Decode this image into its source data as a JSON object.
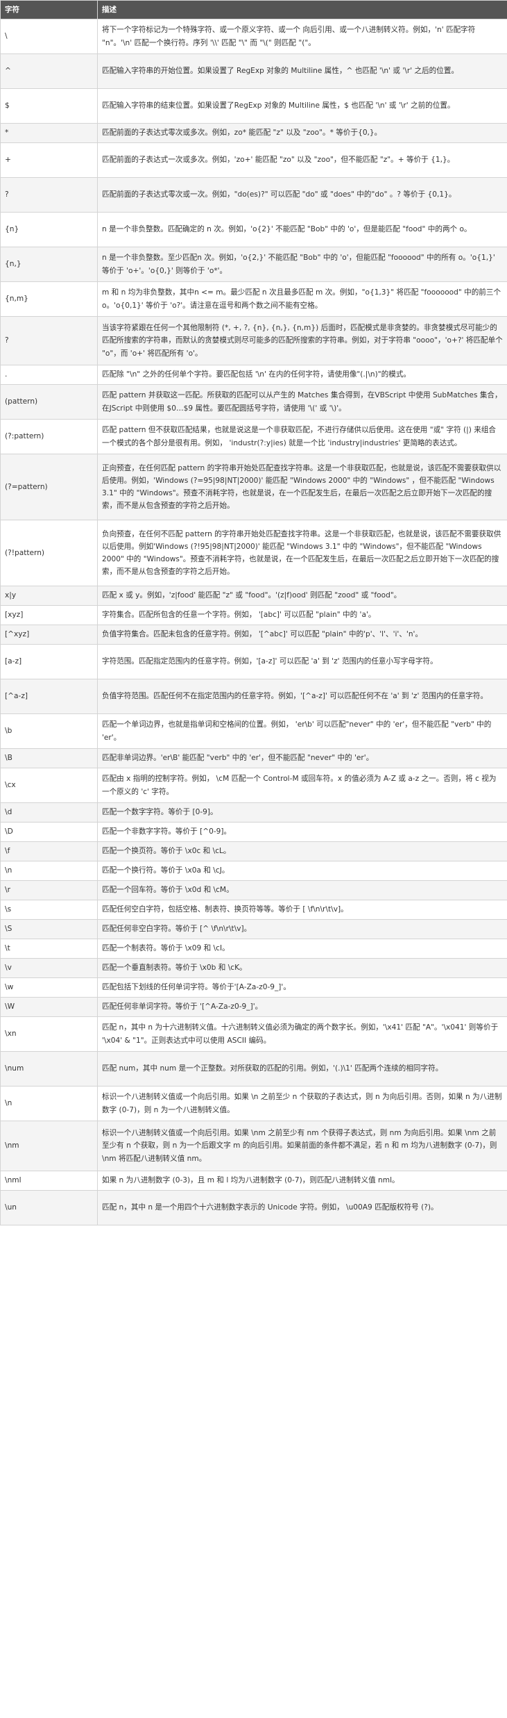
{
  "table": {
    "headers": [
      "字符",
      "描述"
    ],
    "rows": [
      {
        "char": "\\",
        "desc": "将下一个字符标记为一个特殊字符、或一个原义字符、或一个 向后引用、或一个八进制转义符。例如，'n' 匹配字符 \"n\"。'\\n' 匹配一个换行符。序列 '\\\\' 匹配 \"\\\" 而 \"\\(\" 则匹配 \"(\"。"
      },
      {
        "char": "^",
        "desc": "匹配输入字符串的开始位置。如果设置了 RegExp 对象的 Multiline 属性，^ 也匹配 '\\n' 或 '\\r' 之后的位置。"
      },
      {
        "char": "$",
        "desc": "匹配输入字符串的结束位置。如果设置了RegExp 对象的 Multiline 属性，$ 也匹配 '\\n' 或 '\\r' 之前的位置。"
      },
      {
        "char": "*",
        "desc": "匹配前面的子表达式零次或多次。例如，zo* 能匹配 \"z\" 以及 \"zoo\"。* 等价于{0,}。"
      },
      {
        "char": "+",
        "desc": "匹配前面的子表达式一次或多次。例如，'zo+' 能匹配 \"zo\" 以及 \"zoo\"，但不能匹配 \"z\"。+ 等价于 {1,}。"
      },
      {
        "char": "?",
        "desc": "匹配前面的子表达式零次或一次。例如，\"do(es)?\" 可以匹配 \"do\" 或 \"does\" 中的\"do\" 。? 等价于 {0,1}。"
      },
      {
        "char": "{n}",
        "desc": "n 是一个非负整数。匹配确定的 n 次。例如，'o{2}' 不能匹配 \"Bob\" 中的 'o'，但是能匹配 \"food\" 中的两个 o。"
      },
      {
        "char": "{n,}",
        "desc": "n 是一个非负整数。至少匹配n 次。例如，'o{2,}' 不能匹配 \"Bob\" 中的 'o'，但能匹配 \"foooood\" 中的所有 o。'o{1,}' 等价于 'o+'。'o{0,}' 则等价于 'o*'。"
      },
      {
        "char": "{n,m}",
        "desc": "m 和 n 均为非负整数，其中n <= m。最少匹配 n 次且最多匹配 m 次。例如，\"o{1,3}\" 将匹配 \"fooooood\" 中的前三个 o。'o{0,1}' 等价于 'o?'。请注意在逗号和两个数之间不能有空格。"
      },
      {
        "char": "?",
        "desc": "当该字符紧跟在任何一个其他限制符 (*, +, ?, {n}, {n,}, {n,m}) 后面时，匹配模式是非贪婪的。非贪婪模式尽可能少的匹配所搜索的字符串，而默认的贪婪模式则尽可能多的匹配所搜索的字符串。例如，对于字符串 \"oooo\"，'o+?' 将匹配单个 \"o\"，而 'o+' 将匹配所有 'o'。"
      },
      {
        "char": ".",
        "desc": "匹配除 \"\\n\" 之外的任何单个字符。要匹配包括 '\\n' 在内的任何字符，请使用像\"(.|\\n)\"的模式。"
      },
      {
        "char": "(pattern)",
        "desc": "匹配 pattern 并获取这一匹配。所获取的匹配可以从产生的 Matches 集合得到，在VBScript 中使用 SubMatches 集合，在JScript 中则使用 $0…$9 属性。要匹配圆括号字符，请使用 '\\(' 或 '\\)'。"
      },
      {
        "char": "(?:pattern)",
        "desc": "匹配 pattern 但不获取匹配结果，也就是说这是一个非获取匹配，不进行存储供以后使用。这在使用 \"或\" 字符 (|) 来组合一个模式的各个部分是很有用。例如， 'industr(?:y|ies) 就是一个比 'industry|industries' 更简略的表达式。"
      },
      {
        "char": "(?=pattern)",
        "desc": "正向预查，在任何匹配 pattern 的字符串开始处匹配查找字符串。这是一个非获取匹配，也就是说，该匹配不需要获取供以后使用。例如，'Windows (?=95|98|NT|2000)' 能匹配 \"Windows 2000\" 中的 \"Windows\" ，但不能匹配 \"Windows 3.1\" 中的 \"Windows\"。预查不消耗字符，也就是说，在一个匹配发生后，在最后一次匹配之后立即开始下一次匹配的搜索，而不是从包含预查的字符之后开始。"
      },
      {
        "char": "(?!pattern)",
        "desc": "负向预查，在任何不匹配 pattern 的字符串开始处匹配查找字符串。这是一个非获取匹配，也就是说，该匹配不需要获取供以后使用。例如'Windows (?!95|98|NT|2000)' 能匹配 \"Windows 3.1\" 中的 \"Windows\"，但不能匹配 \"Windows 2000\" 中的 \"Windows\"。预查不消耗字符，也就是说，在一个匹配发生后，在最后一次匹配之后立即开始下一次匹配的搜索，而不是从包含预查的字符之后开始。"
      },
      {
        "char": "x|y",
        "desc": "匹配 x 或 y。例如，'z|food' 能匹配 \"z\" 或 \"food\"。'(z|f)ood' 则匹配 \"zood\" 或 \"food\"。"
      },
      {
        "char": "[xyz]",
        "desc": "字符集合。匹配所包含的任意一个字符。例如， '[abc]' 可以匹配 \"plain\" 中的 'a'。"
      },
      {
        "char": "[^xyz]",
        "desc": "负值字符集合。匹配未包含的任意字符。例如， '[^abc]' 可以匹配 \"plain\" 中的'p'、'l'、'i'、'n'。"
      },
      {
        "char": "[a-z]",
        "desc": "字符范围。匹配指定范围内的任意字符。例如，'[a-z]' 可以匹配 'a' 到 'z' 范围内的任意小写字母字符。"
      },
      {
        "char": "[^a-z]",
        "desc": "负值字符范围。匹配任何不在指定范围内的任意字符。例如，'[^a-z]' 可以匹配任何不在 'a' 到 'z' 范围内的任意字符。"
      },
      {
        "char": "\\b",
        "desc": "匹配一个单词边界，也就是指单词和空格间的位置。例如， 'er\\b' 可以匹配\"never\" 中的 'er'，但不能匹配 \"verb\" 中的 'er'。"
      },
      {
        "char": "\\B",
        "desc": "匹配非单词边界。'er\\B' 能匹配 \"verb\" 中的 'er'，但不能匹配 \"never\" 中的 'er'。"
      },
      {
        "char": "\\cx",
        "desc": "匹配由 x 指明的控制字符。例如， \\cM 匹配一个 Control-M 或回车符。x 的值必须为 A-Z 或 a-z 之一。否则，将 c 视为一个原义的 'c' 字符。"
      },
      {
        "char": "\\d",
        "desc": "匹配一个数字字符。等价于 [0-9]。"
      },
      {
        "char": "\\D",
        "desc": "匹配一个非数字字符。等价于 [^0-9]。"
      },
      {
        "char": "\\f",
        "desc": "匹配一个换页符。等价于 \\x0c 和 \\cL。"
      },
      {
        "char": "\\n",
        "desc": "匹配一个换行符。等价于 \\x0a 和 \\cJ。"
      },
      {
        "char": "\\r",
        "desc": "匹配一个回车符。等价于 \\x0d 和 \\cM。"
      },
      {
        "char": "\\s",
        "desc": "匹配任何空白字符，包括空格、制表符、换页符等等。等价于 [ \\f\\n\\r\\t\\v]。"
      },
      {
        "char": "\\S",
        "desc": "匹配任何非空白字符。等价于 [^ \\f\\n\\r\\t\\v]。"
      },
      {
        "char": "\\t",
        "desc": "匹配一个制表符。等价于 \\x09 和 \\cI。"
      },
      {
        "char": "\\v",
        "desc": "匹配一个垂直制表符。等价于 \\x0b 和 \\cK。"
      },
      {
        "char": "\\w",
        "desc": "匹配包括下划线的任何单词字符。等价于'[A-Za-z0-9_]'。"
      },
      {
        "char": "\\W",
        "desc": "匹配任何非单词字符。等价于 '[^A-Za-z0-9_]'。"
      },
      {
        "char": "\\xn",
        "desc": "匹配 n，其中 n 为十六进制转义值。十六进制转义值必须为确定的两个数字长。例如，'\\x41' 匹配 \"A\"。'\\x041' 则等价于 '\\x04' & \"1\"。正则表达式中可以使用 ASCII 编码。"
      },
      {
        "char": "\\num",
        "desc": "匹配 num，其中 num 是一个正整数。对所获取的匹配的引用。例如，'(.)\\1' 匹配两个连续的相同字符。"
      },
      {
        "char": "\\n",
        "desc": "标识一个八进制转义值或一个向后引用。如果 \\n 之前至少 n 个获取的子表达式，则 n 为向后引用。否则，如果 n 为八进制数字 (0-7)，则 n 为一个八进制转义值。"
      },
      {
        "char": "\\nm",
        "desc": "标识一个八进制转义值或一个向后引用。如果 \\nm 之前至少有 nm 个获得子表达式，则 nm 为向后引用。如果 \\nm 之前至少有 n 个获取，则 n 为一个后跟文字 m 的向后引用。如果前面的条件都不满足，若 n 和 m 均为八进制数字 (0-7)，则 \\nm 将匹配八进制转义值 nm。"
      },
      {
        "char": "\\nml",
        "desc": "如果 n 为八进制数字 (0-3)，且 m 和 l 均为八进制数字 (0-7)，则匹配八进制转义值 nml。"
      },
      {
        "char": "\\un",
        "desc": "匹配 n，其中 n 是一个用四个十六进制数字表示的 Unicode 字符。例如， \\u00A9 匹配版权符号 (?)。"
      }
    ]
  }
}
